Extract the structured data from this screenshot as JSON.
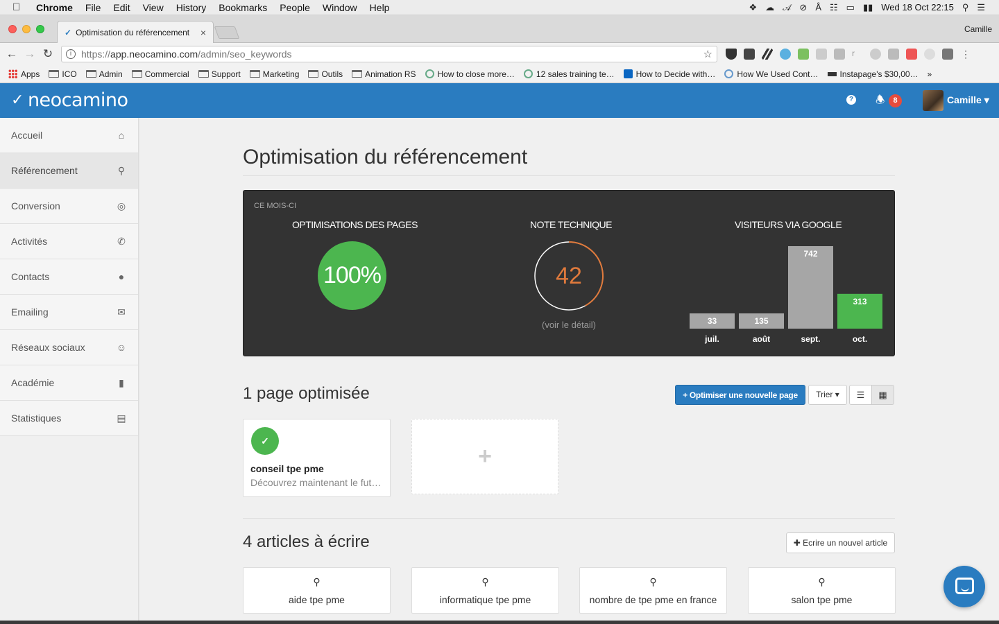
{
  "menubar": {
    "app": "Chrome",
    "items": [
      "File",
      "Edit",
      "View",
      "History",
      "Bookmarks",
      "People",
      "Window",
      "Help"
    ],
    "clock": "Wed 18 Oct  22:15"
  },
  "browser": {
    "tab_title": "Optimisation du référencement",
    "profile": "Camille",
    "url_scheme": "https://",
    "url_host": "app.neocamino.com",
    "url_path": "/admin/seo_keywords",
    "bookmarks": [
      "Apps",
      "ICO",
      "Admin",
      "Commercial",
      "Support",
      "Marketing",
      "Outils",
      "Animation RS",
      "How to close more…",
      "12 sales training te…",
      "How to Decide with…",
      "How We Used Cont…",
      "Instapage's $30,00…"
    ]
  },
  "header": {
    "logo": "neocamino",
    "notifications": "8",
    "user": "Camille"
  },
  "sidebar": {
    "items": [
      {
        "label": "Accueil",
        "icon": "home-icon"
      },
      {
        "label": "Référencement",
        "icon": "search-icon"
      },
      {
        "label": "Conversion",
        "icon": "target-icon"
      },
      {
        "label": "Activités",
        "icon": "phone-icon"
      },
      {
        "label": "Contacts",
        "icon": "user-icon"
      },
      {
        "label": "Emailing",
        "icon": "envelope-icon"
      },
      {
        "label": "Réseaux sociaux",
        "icon": "smile-icon"
      },
      {
        "label": "Académie",
        "icon": "book-icon"
      },
      {
        "label": "Statistiques",
        "icon": "bar-chart-icon"
      }
    ]
  },
  "page": {
    "title": "Optimisation du référencement",
    "stats": {
      "period": "CE MOIS-CI",
      "optim_label": "OPTIMISATIONS DES PAGES",
      "optim_value": "100%",
      "note_label": "NOTE TECHNIQUE",
      "note_value": "42",
      "note_max": 100,
      "note_link": "(voir le détail)",
      "visitors_label": "VISITEURS VIA GOOGLE"
    },
    "pages_title": "1 page optimisée",
    "optimize_button": "+ Optimiser une nouvelle page",
    "sort_button": "Trier ▾",
    "optimized_pages": [
      {
        "keyword": "conseil tpe pme",
        "description": "Découvrez maintenant le fut…"
      }
    ],
    "articles_title": "4 articles à écrire",
    "write_button": "✚ Ecrire un nouvel article",
    "articles": [
      "aide tpe pme",
      "informatique tpe pme",
      "nombre de tpe pme en france",
      "salon tpe pme"
    ]
  },
  "colors": {
    "brand": "#2a7cc0",
    "success": "#4cb64f",
    "gauge": "#e07a3c",
    "bar_gray": "#a6a6a6"
  },
  "chart_data": {
    "type": "bar",
    "title": "VISITEURS VIA GOOGLE",
    "categories": [
      "juil.",
      "août",
      "sept.",
      "oct."
    ],
    "values": [
      33,
      135,
      742,
      313
    ],
    "highlight_last": true,
    "ylim": [
      0,
      742
    ]
  }
}
